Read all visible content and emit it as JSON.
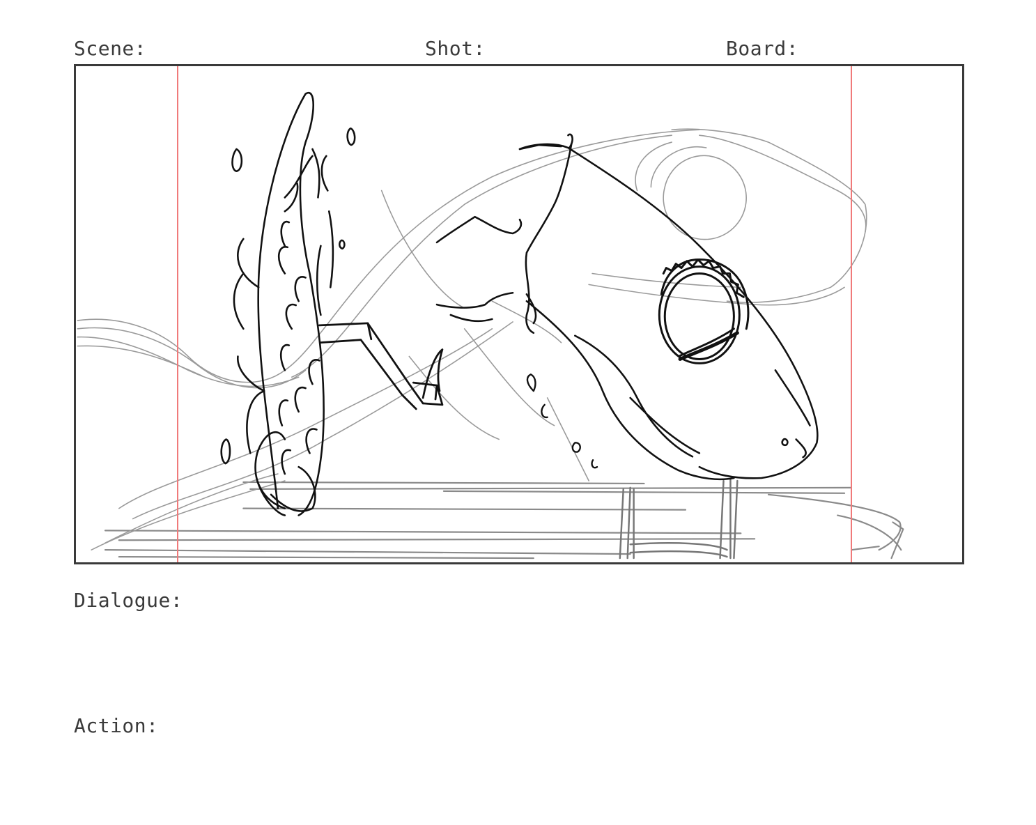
{
  "header": {
    "scene_label": "Scene:",
    "shot_label": "Shot:",
    "board_label": "Board:"
  },
  "panel": {
    "sketch": "chameleon-sketch",
    "guide_color": "#f07a7a",
    "stroke_dark": "#111111",
    "stroke_light": "#8a8a8a"
  },
  "footer": {
    "dialogue_label": "Dialogue:",
    "action_label": "Action:"
  }
}
